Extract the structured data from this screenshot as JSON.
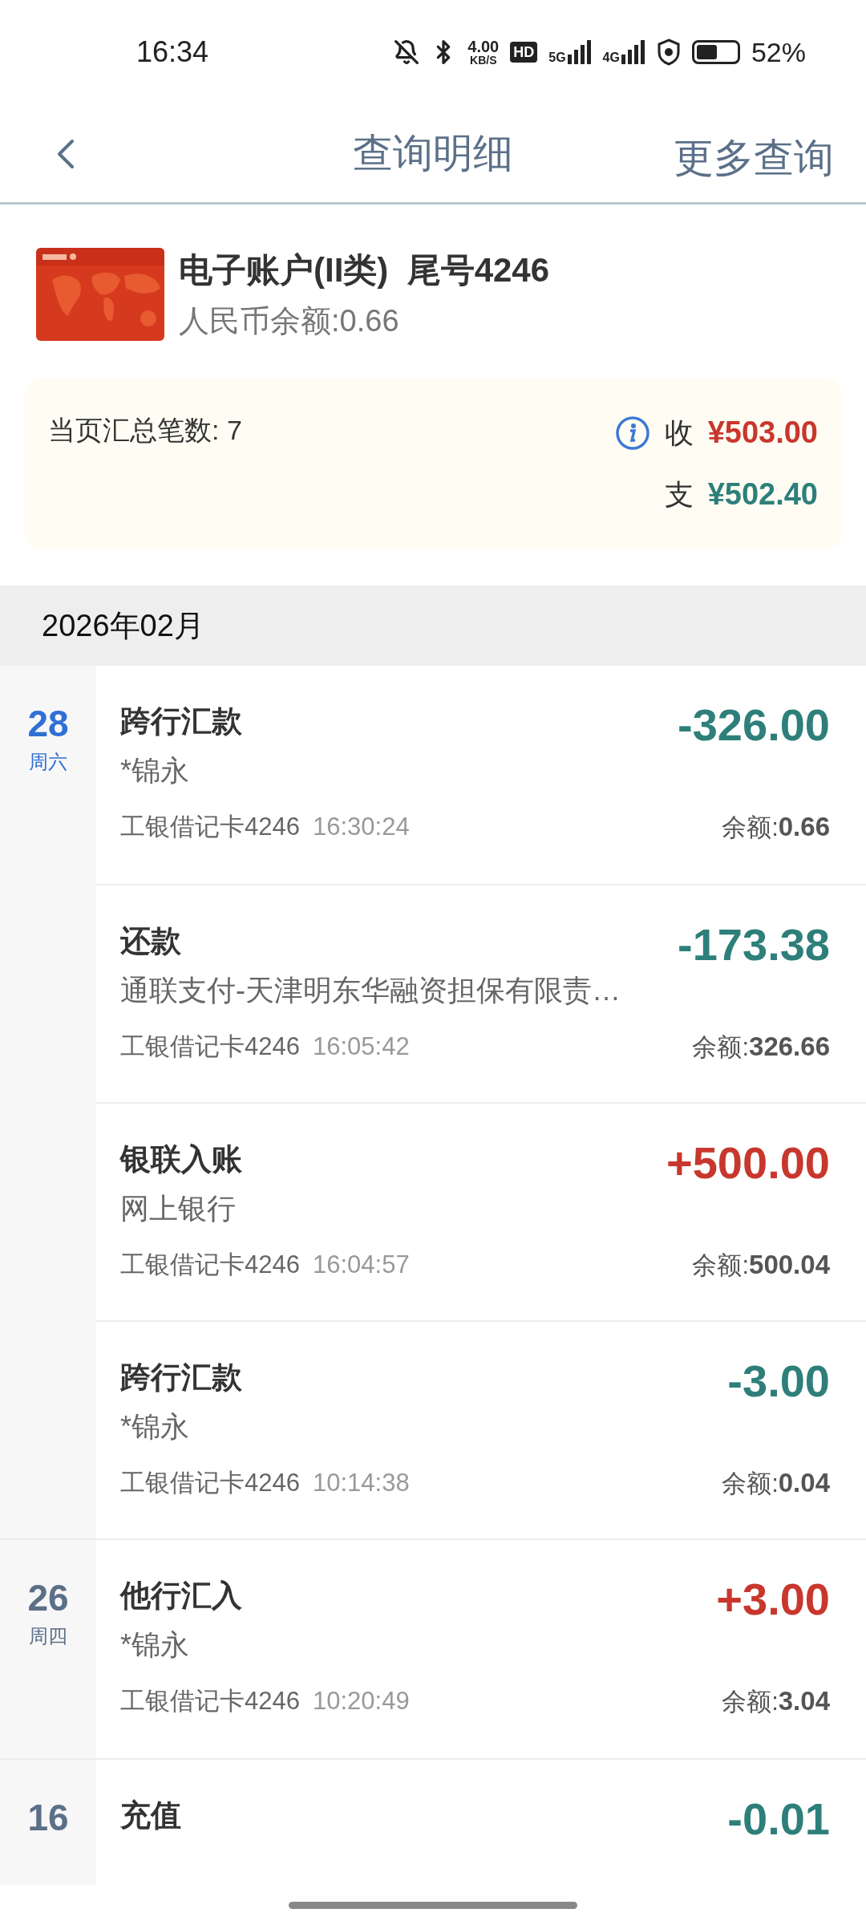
{
  "status_bar": {
    "time": "16:34",
    "speed_value": "4.00",
    "speed_unit": "KB/S",
    "hd_label": "HD",
    "network_1": "5G",
    "network_2": "4G",
    "battery_text": "52%"
  },
  "header": {
    "title": "查询明细",
    "action": "更多查询"
  },
  "account": {
    "name": "电子账户(II类)  尾号4246",
    "balance": "人民币余额:0.66"
  },
  "summary": {
    "count": "当页汇总笔数: 7",
    "income_label": "收",
    "income": "¥503.00",
    "expense_label": "支",
    "expense": "¥502.40"
  },
  "month": "2026年02月",
  "groups": [
    {
      "day": "28",
      "weekday": "周六",
      "color": "#2f6fd6",
      "items": [
        {
          "title": "跨行汇款",
          "subtitle": "*锦永",
          "amount": "-326.00",
          "kind": "expense",
          "card": "工银借记卡4246",
          "time": "16:30:24",
          "balance_label": "余额:",
          "balance": "0.66"
        },
        {
          "title": "还款",
          "subtitle": "通联支付-天津明东华融资担保有限责…",
          "amount": "-173.38",
          "kind": "expense",
          "card": "工银借记卡4246",
          "time": "16:05:42",
          "balance_label": "余额:",
          "balance": "326.66"
        },
        {
          "title": "银联入账",
          "subtitle": "网上银行",
          "amount": "+500.00",
          "kind": "income",
          "card": "工银借记卡4246",
          "time": "16:04:57",
          "balance_label": "余额:",
          "balance": "500.04"
        },
        {
          "title": "跨行汇款",
          "subtitle": "*锦永",
          "amount": "-3.00",
          "kind": "expense",
          "card": "工银借记卡4246",
          "time": "10:14:38",
          "balance_label": "余额:",
          "balance": "0.04"
        }
      ]
    },
    {
      "day": "26",
      "weekday": "周四",
      "color": "#5b7088",
      "items": [
        {
          "title": "他行汇入",
          "subtitle": "*锦永",
          "amount": "+3.00",
          "kind": "income",
          "card": "工银借记卡4246",
          "time": "10:20:49",
          "balance_label": "余额:",
          "balance": "3.04"
        }
      ]
    },
    {
      "day": "16",
      "color": "#5b7088",
      "items": [
        {
          "title": "充值",
          "amount": "-0.01",
          "kind": "expense"
        }
      ]
    }
  ]
}
